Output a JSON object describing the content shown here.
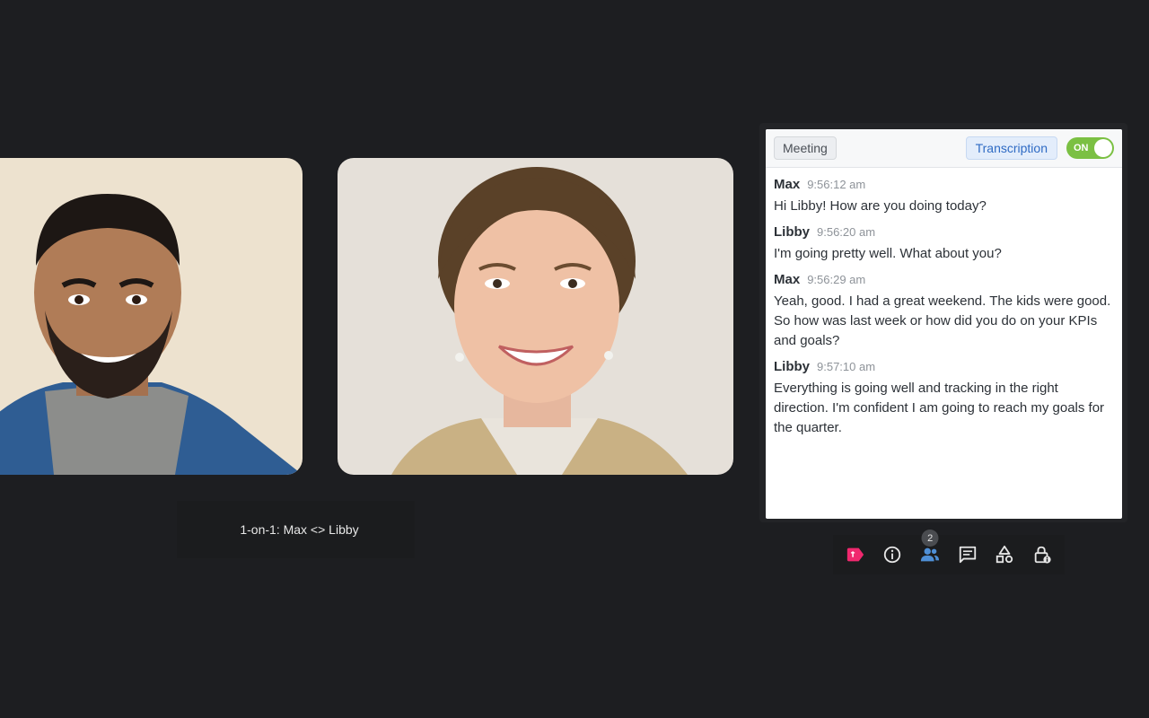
{
  "participants": [
    {
      "name": "Max"
    },
    {
      "name": "Libby"
    }
  ],
  "meeting": {
    "title": "1-on-1: Max <> Libby"
  },
  "panel": {
    "tab_meeting": "Meeting",
    "tab_transcription": "Transcription",
    "toggle_label": "ON",
    "messages": [
      {
        "speaker": "Max",
        "time": "9:56:12 am",
        "text": "Hi Libby! How are you doing today?"
      },
      {
        "speaker": "Libby",
        "time": "9:56:20 am",
        "text": "I'm going pretty well. What about you?"
      },
      {
        "speaker": "Max",
        "time": "9:56:29 am",
        "text": "Yeah, good. I had a great weekend. The kids were good. So how was last week or how did you do on your KPIs and goals?"
      },
      {
        "speaker": "Libby",
        "time": "9:57:10 am",
        "text": "Everything is going well and tracking in the right direction. I'm confident I am going to reach my goals for the quarter."
      }
    ]
  },
  "toolbar": {
    "participant_count": "2",
    "icons": [
      "tag-icon",
      "info-icon",
      "people-icon",
      "chat-icon",
      "shapes-icon",
      "lock-icon"
    ]
  },
  "colors": {
    "background": "#1d1e21",
    "toggle_on": "#7bc043",
    "tag_accent": "#f0286e",
    "people_accent": "#4f8fd6"
  }
}
